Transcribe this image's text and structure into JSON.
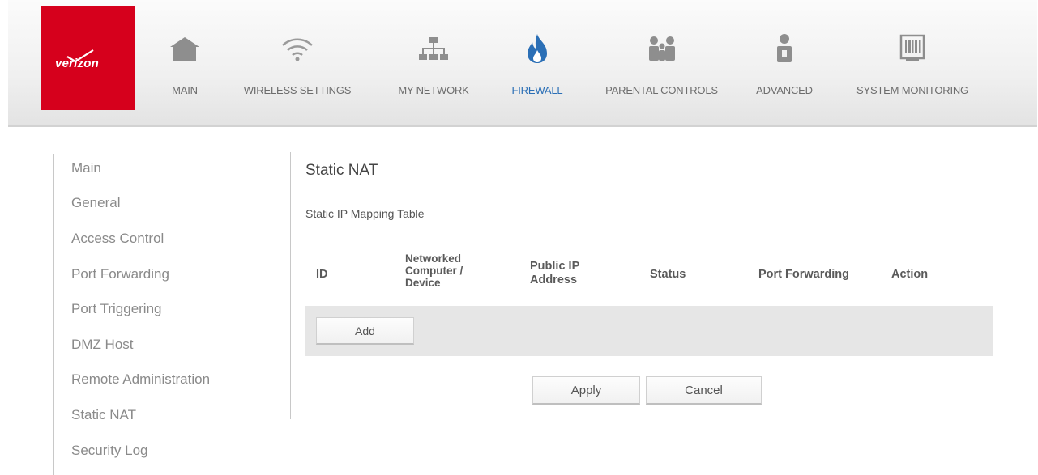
{
  "brand": {
    "name": "verizon",
    "color": "#d6001c"
  },
  "nav": [
    {
      "label": "MAIN",
      "icon": "house-icon"
    },
    {
      "label": "WIRELESS SETTINGS",
      "icon": "wifi-icon"
    },
    {
      "label": "MY NETWORK",
      "icon": "network-icon"
    },
    {
      "label": "FIREWALL",
      "icon": "flame-icon",
      "active": true
    },
    {
      "label": "PARENTAL CONTROLS",
      "icon": "family-icon"
    },
    {
      "label": "ADVANCED",
      "icon": "advanced-user-icon"
    },
    {
      "label": "SYSTEM MONITORING",
      "icon": "monitor-barcode-icon"
    }
  ],
  "sidebar": {
    "items": [
      {
        "label": "Main"
      },
      {
        "label": "General"
      },
      {
        "label": "Access Control"
      },
      {
        "label": "Port Forwarding"
      },
      {
        "label": "Port Triggering"
      },
      {
        "label": "DMZ Host"
      },
      {
        "label": "Remote Administration"
      },
      {
        "label": "Static NAT"
      },
      {
        "label": "Security Log"
      }
    ]
  },
  "main": {
    "title": "Static NAT",
    "subtitle": "Static IP Mapping Table",
    "table": {
      "headers": {
        "id": "ID",
        "device_1": "Networked",
        "device_2": "Computer /",
        "device_3": "Device",
        "public_ip_1": "Public IP",
        "public_ip_2": "Address",
        "status": "Status",
        "port_forwarding": "Port Forwarding",
        "action": "Action"
      },
      "add_label": "Add"
    },
    "apply_label": "Apply",
    "cancel_label": "Cancel"
  },
  "colors": {
    "active_nav": "#2b6fb6",
    "icon_gray": "#8e8e8e",
    "flame": "#2b6fb6"
  }
}
